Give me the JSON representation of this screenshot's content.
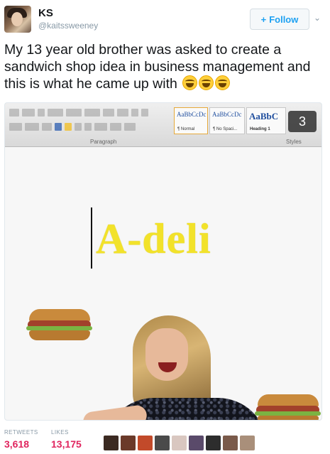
{
  "user": {
    "display_name": "KS",
    "handle": "@kaitssweeney"
  },
  "follow": {
    "label": "Follow",
    "plus_icon": "follow-person-plus-icon",
    "menu_icon": "chevron-down-icon"
  },
  "tweet": {
    "text": "My 13 year old brother was asked to create a sandwich shop idea in business management and this is what he came up with",
    "emojis": [
      "face-with-tears-of-joy-icon",
      "face-with-tears-of-joy-icon",
      "face-with-tears-of-joy-icon"
    ]
  },
  "media": {
    "counter": "3",
    "ribbon": {
      "paragraph_label": "Paragraph",
      "styles_label": "Styles",
      "styles": [
        {
          "preview": "AaBbCcDc",
          "name": "¶ Normal"
        },
        {
          "preview": "AaBbCcDc",
          "name": "¶ No Spaci..."
        },
        {
          "preview": "AaBbC",
          "name": "Heading 1"
        }
      ]
    },
    "document_text": "A-deli"
  },
  "stats": {
    "retweets_label": "RETWEETS",
    "retweets": "3,618",
    "likes_label": "LIKES",
    "likes": "13,175"
  },
  "likers": [
    "#3b2a22",
    "#6b3a2a",
    "#c24a2a",
    "#4a4a4a",
    "#d9c7c0",
    "#5a4a6a",
    "#2d2d2d",
    "#7a5a4a",
    "#a98f7a"
  ],
  "colors": {
    "accent": "#1da1f2",
    "like_count": "#e0245e",
    "brand_text": "#f2e22a"
  }
}
